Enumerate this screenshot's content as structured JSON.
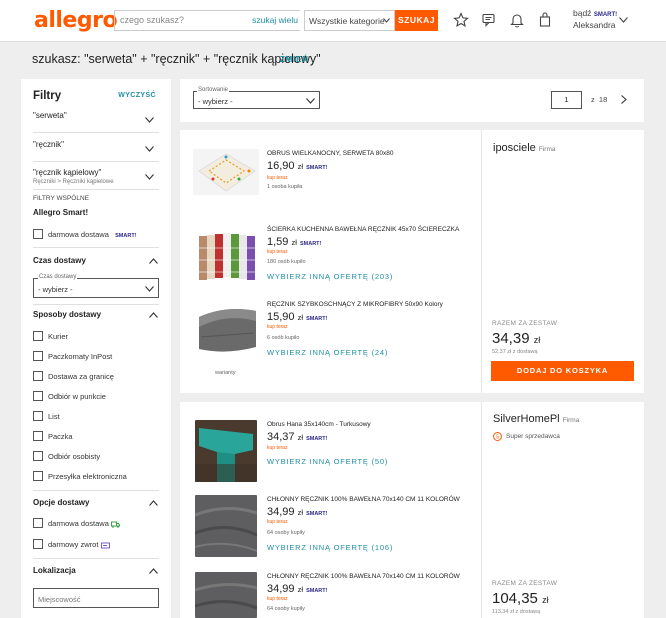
{
  "header": {
    "logo": "allegro",
    "search_placeholder": "czego szukasz?",
    "search_many": "szukaj wielu",
    "category": "Wszystkie kategorie",
    "search_button": "SZUKAJ",
    "account_top": "bądź",
    "account_smart": "SMART!",
    "account_name": "Aleksandra"
  },
  "query": {
    "text": "szukasz: \"serweta\" + \"ręcznik\" + \"ręcznik kąpielowy\"",
    "change": "ZMIEŃ"
  },
  "sidebar": {
    "title": "Filtry",
    "clear": "WYCZYŚĆ",
    "terms": [
      {
        "label": "\"serweta\""
      },
      {
        "label": "\"ręcznik\""
      },
      {
        "label": "\"ręcznik kąpielowy\"",
        "sub": "Ręczniki > Ręczniki kąpielowe"
      }
    ],
    "common_filters": "FILTRY WSPÓLNE",
    "allegro_smart": "Allegro Smart!",
    "free_delivery_smart": "darmowa dostawa",
    "smart_badge": "SMART!",
    "delivery_time": {
      "title": "Czas dostawy",
      "select_label": "Czas dostawy",
      "select_value": "- wybierz -"
    },
    "delivery_methods": {
      "title": "Sposoby dostawy",
      "options": [
        "Kurier",
        "Paczkomaty InPost",
        "Dostawa za granicę",
        "Odbiór w punkcie",
        "List",
        "Paczka",
        "Odbiór osobisty",
        "Przesyłka elektroniczna"
      ]
    },
    "delivery_options": {
      "title": "Opcje dostawy",
      "options": [
        "darmowa dostawa",
        "darmowy zwrot"
      ]
    },
    "location": {
      "title": "Lokalizacja",
      "placeholder": "Miejscowość"
    }
  },
  "controls": {
    "sort_label": "Sortowanie",
    "sort_value": "- wybierz -",
    "page": "1",
    "page_of": "z",
    "total_pages": "18"
  },
  "offers": [
    {
      "seller": "iposciele",
      "seller_type": "Firma",
      "items": [
        {
          "title": "OBRUS WIELKANOCNY, SERWETA 80x80",
          "price_main": "16,90",
          "price_cur": "zł",
          "smart": "SMART!",
          "buy_now": "kup teraz",
          "people": "1 osoba kupiła"
        },
        {
          "title": "ŚCIERKA KUCHENNA BAWEŁNA RĘCZNIK 45x70 ŚCIERECZKA",
          "price_main": "1,59",
          "price_cur": "zł",
          "smart": "SMART!",
          "buy_now": "kup teraz",
          "people": "180 osób kupiło",
          "other": "WYBIERZ INNĄ OFERTĘ (203)"
        },
        {
          "title": "RĘCZNIK SZYBKOSCHNĄCY Z MIKROFIBRY 50x90 Kolory",
          "price_main": "15,90",
          "price_cur": "zł",
          "smart": "SMART!",
          "buy_now": "kup teraz",
          "people": "6 osób kupiło",
          "other": "WYBIERZ INNĄ OFERTĘ (24)",
          "variant": "warianty"
        }
      ],
      "total_label": "RAZEM ZA ZESTAW",
      "total_main": "34,39",
      "total_cur": "zł",
      "total_delivery": "52,37 zł z dostawą",
      "add_button": "DODAJ DO KOSZYKA"
    },
    {
      "seller": "SilverHomePl",
      "seller_type": "Firma",
      "super_seller": "Super sprzedawca",
      "items": [
        {
          "title": "Obrus Hana 35x140cm - Turkusowy",
          "price_main": "34,37",
          "price_cur": "zł",
          "smart": "SMART!",
          "buy_now": "kup teraz",
          "other": "WYBIERZ INNĄ OFERTĘ (50)"
        },
        {
          "title": "CHŁONNY RĘCZNIK 100% BAWEŁNA 70x140 CM 11 KOLORÓW",
          "price_main": "34,99",
          "price_cur": "zł",
          "smart": "SMART!",
          "buy_now": "kup teraz",
          "people": "64 osoby kupiły",
          "other": "WYBIERZ INNĄ OFERTĘ (106)"
        },
        {
          "title": "CHŁONNY RĘCZNIK 100% BAWEŁNA 70x140 CM 11 KOLORÓW",
          "price_main": "34,99",
          "price_cur": "zł",
          "smart": "SMART!",
          "buy_now": "kup teraz",
          "people": "64 osoby kupiły"
        }
      ],
      "total_label": "RAZEM ZA ZESTAW",
      "total_main": "104,35",
      "total_cur": "zł",
      "total_delivery": "113,34 zł z dostawą"
    }
  ],
  "colors": {
    "accent": "#ff5a00",
    "link": "#1f8fa3",
    "background": "#eeeeee"
  }
}
